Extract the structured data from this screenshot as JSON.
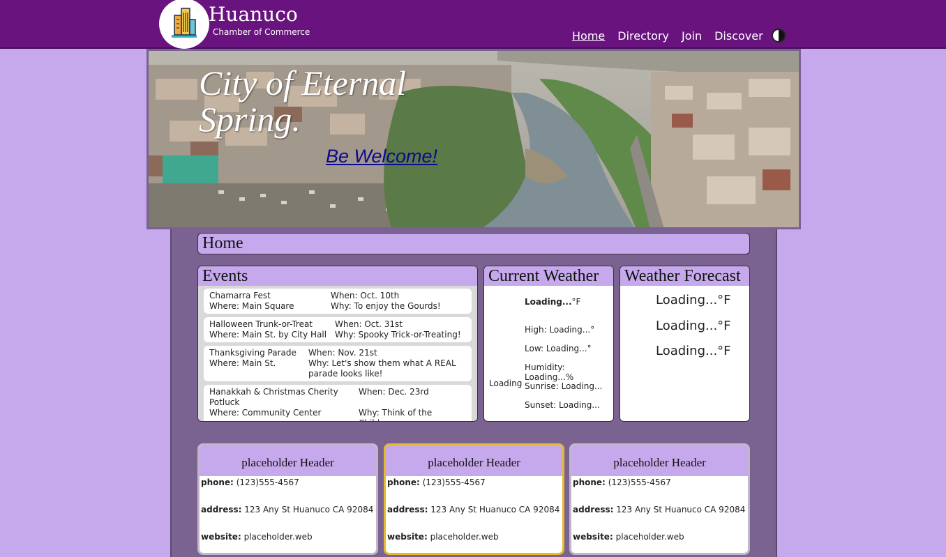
{
  "header": {
    "brand_name": "Huanuco",
    "brand_sub": "Chamber of Commerce",
    "nav": [
      {
        "label": "Home",
        "active": true
      },
      {
        "label": "Directory"
      },
      {
        "label": "Join"
      },
      {
        "label": "Discover"
      }
    ]
  },
  "hero": {
    "title": "City of Eternal Spring.",
    "welcome": "Be Welcome!"
  },
  "page_heading": "Home",
  "events": {
    "title": "Events",
    "items": [
      {
        "name": "Chamarra Fest",
        "when": "When: Oct. 10th",
        "where": "Where: Main Square",
        "why": "Why: To enjoy the Gourds!"
      },
      {
        "name": "Halloween Trunk-or-Treat",
        "when": "When: Oct. 31st",
        "where": "Where: Main St. by City Hall",
        "why": "Why: Spooky Trick-or-Treating!"
      },
      {
        "name": "Thanksgiving Parade",
        "when": "When: Nov. 21st",
        "where": "Where: Main St.",
        "why": "Why: Let's show them what A REAL parade looks like!"
      },
      {
        "name": "Hanakkah & Christmas Cherity Potluck",
        "when": "When: Dec. 23rd",
        "where": "Where: Community Center",
        "why": "Why: Think of the Children"
      }
    ]
  },
  "weather": {
    "title": "Current Weather",
    "icon_text": "Loading",
    "temp_value": "Loading...",
    "temp_unit": "°F",
    "high": "High: Loading...°",
    "low": "Low: Loading...°",
    "humidity": "Humidity: Loading...%",
    "sunrise": "Sunrise: Loading...",
    "sunset": "Sunset: Loading..."
  },
  "forecast": {
    "title": "Weather Forecast",
    "days": [
      "Loading...°F",
      "Loading...°F",
      "Loading...°F"
    ]
  },
  "businesses": [
    {
      "header": "placeholder Header",
      "phone_label": "phone:",
      "phone": "(123)555-4567",
      "address_label": "address:",
      "address": "123 Any St Huanuco CA 92084",
      "website_label": "website:",
      "website": "placeholder.web"
    },
    {
      "header": "placeholder Header",
      "phone_label": "phone:",
      "phone": "(123)555-4567",
      "address_label": "address:",
      "address": "123 Any St Huanuco CA 92084",
      "website_label": "website:",
      "website": "placeholder.web"
    },
    {
      "header": "placeholder Header",
      "phone_label": "phone:",
      "phone": "(123)555-4567",
      "address_label": "address:",
      "address": "123 Any St Huanuco CA 92084",
      "website_label": "website:",
      "website": "placeholder.web"
    }
  ],
  "colors": {
    "header_bg": "#69137e",
    "page_bg": "#c6a9ec",
    "main_bg": "#7a6391",
    "featured_border": "#e8b92a"
  }
}
